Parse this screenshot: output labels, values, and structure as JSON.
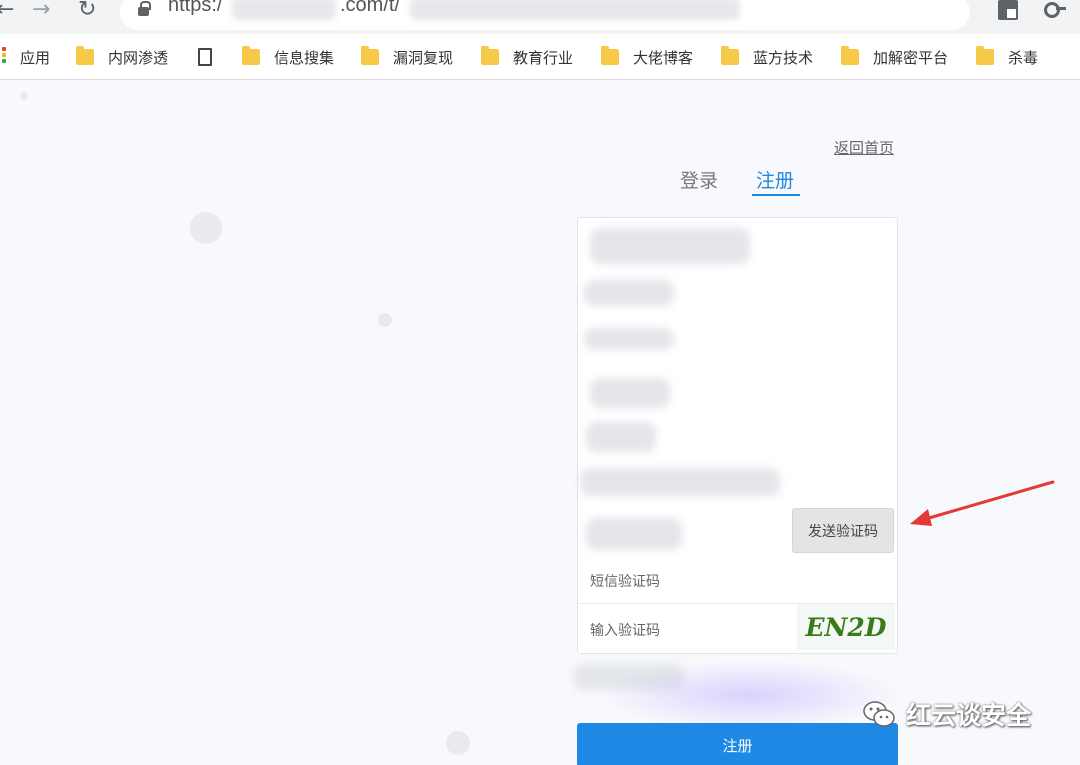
{
  "browser": {
    "url_scheme": "https:/",
    "url_domain_suffix": ".com/t/",
    "nav": {
      "back": "←",
      "forward": "→",
      "reload": "↻"
    },
    "bookmarks": [
      {
        "label": "应用",
        "icon": "apps-icon"
      },
      {
        "label": "内网渗透",
        "icon": "folder-icon"
      },
      {
        "label": "",
        "icon": "page-icon"
      },
      {
        "label": "信息搜集",
        "icon": "folder-icon"
      },
      {
        "label": "漏洞复现",
        "icon": "folder-icon"
      },
      {
        "label": "教育行业",
        "icon": "folder-icon"
      },
      {
        "label": "大佬博客",
        "icon": "folder-icon"
      },
      {
        "label": "蓝方技术",
        "icon": "folder-icon"
      },
      {
        "label": "加解密平台",
        "icon": "folder-icon"
      },
      {
        "label": "杀毒",
        "icon": "folder-icon"
      }
    ]
  },
  "page": {
    "back_home": "返回首页",
    "tabs": {
      "login": "登录",
      "register": "注册"
    },
    "form": {
      "send_code_button": "发送验证码",
      "sms_code_placeholder": "短信验证码",
      "captcha_placeholder": "输入验证码",
      "captcha_text": "EN2D",
      "submit_button": "注册"
    }
  },
  "watermark": {
    "text": "红云谈安全"
  },
  "colors": {
    "accent": "#1e88e5",
    "annotation_arrow": "#e53935",
    "captcha": "#3a7a18"
  }
}
